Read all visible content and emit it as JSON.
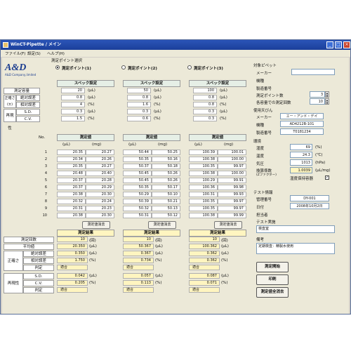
{
  "window": {
    "title": "WinCT-Pipette / メイン"
  },
  "menu": [
    "ファイル(F)",
    "設定(S)",
    "ヘルプ(H)"
  ],
  "logo": {
    "text": "A&D",
    "sub": "A&D Company,limited"
  },
  "selection": {
    "title": "測定ポイント選択",
    "points": [
      "測定ポイント(1)",
      "測定ポイント(2)",
      "測定ポイント(3)"
    ],
    "selected": 0
  },
  "spec": {
    "row_labels": {
      "volume": "測定容量",
      "accuracy": "正確さ(±)",
      "abs": "絶対誤差",
      "rel": "相対誤差",
      "repeat": "再現性",
      "sd": "S.D.",
      "cv": "C.V."
    },
    "header": "スペック設定",
    "columns": [
      {
        "volume": "20",
        "abs": "0.8",
        "rel": "4",
        "sd": "0.3",
        "cv": "1.5"
      },
      {
        "volume": "50",
        "abs": "0.8",
        "rel": "1.6",
        "sd": "0.3",
        "cv": "0.6"
      },
      {
        "volume": "100",
        "abs": "0.8",
        "rel": "0.8",
        "sd": "0.3",
        "cv": "0.3"
      }
    ],
    "units": {
      "volume": "(μL)",
      "abs": "(μL)",
      "rel": "(%)",
      "sd": "(μL)",
      "cv": "(%)"
    }
  },
  "measurement": {
    "header": "測定値",
    "sub": [
      "(μL)",
      "(mg)"
    ],
    "row_header": "No.",
    "rows": [
      "1",
      "2",
      "3",
      "4",
      "5",
      "6",
      "7",
      "8",
      "9",
      "10"
    ],
    "columns": [
      {
        "ul": [
          "20.35",
          "20.34",
          "20.35",
          "20.48",
          "20.37",
          "20.37",
          "20.38",
          "20.32",
          "20.31",
          "20.38"
        ],
        "mg": [
          "20.27",
          "20.26",
          "20.27",
          "20.40",
          "20.28",
          "20.29",
          "20.30",
          "20.24",
          "20.23",
          "20.30"
        ]
      },
      {
        "ul": [
          "50.44",
          "50.35",
          "50.37",
          "50.45",
          "50.45",
          "50.35",
          "50.29",
          "50.39",
          "50.32",
          "50.31"
        ],
        "mg": [
          "50.25",
          "50.16",
          "50.18",
          "50.26",
          "50.26",
          "50.17",
          "50.10",
          "50.21",
          "50.13",
          "50.12"
        ]
      },
      {
        "ul": [
          "100.39",
          "100.38",
          "100.35",
          "100.38",
          "100.29",
          "100.36",
          "100.31",
          "100.35",
          "100.35",
          "100.38"
        ],
        "mg": [
          "100.01",
          "100.00",
          "99.97",
          "100.00",
          "99.91",
          "99.98",
          "99.93",
          "99.97",
          "99.97",
          "99.99"
        ]
      }
    ],
    "clear_label": "測定値消去"
  },
  "results": {
    "header": "測定結果",
    "row_labels": {
      "count": "測定回数",
      "mean": "平均値",
      "accuracy": "正確さ",
      "abs": "絶対誤差",
      "rel": "相対誤差",
      "judge": "判定",
      "repeat": "再現性",
      "sd": "S.D.",
      "cv": "C.V.",
      "judge2": "判定"
    },
    "columns": [
      {
        "count": "10",
        "mean": "20.350",
        "abs": "0.350",
        "rel": "1.750",
        "judge": "適合",
        "sd": "0.042",
        "cv": "0.205",
        "judge2": "適合"
      },
      {
        "count": "10",
        "mean": "50.367",
        "abs": "0.367",
        "rel": "0.734",
        "judge": "適合",
        "sd": "0.057",
        "cv": "0.113",
        "judge2": "適合"
      },
      {
        "count": "10",
        "mean": "100.362",
        "abs": "0.362",
        "rel": "0.362",
        "judge": "適合",
        "sd": "0.087",
        "cv": "0.071",
        "judge2": "適合"
      }
    ],
    "units": {
      "count": "(回)",
      "mean": "(μL)",
      "abs": "(μL)",
      "rel": "(%)",
      "sd": "(μL)",
      "cv": "(%)"
    }
  },
  "target_pipette": {
    "title": "対象ピペット",
    "maker_label": "メーカー",
    "maker": "",
    "model_label": "機種",
    "model": "",
    "serial_label": "製造番号",
    "serial": "",
    "points_label": "測定ポイント数",
    "points": "3",
    "count_label": "各容量での測定回数",
    "count": "10"
  },
  "balance": {
    "title": "使用天びん",
    "maker_label": "メーカー",
    "maker": "エー・アンド・デイ",
    "model_label": "機種",
    "model": "AD4212B-101",
    "serial_label": "製造番号",
    "serial": "T0181234"
  },
  "environment": {
    "title": "環境",
    "humidity_label": "湿度",
    "humidity": "69",
    "humidity_unit": "(%)",
    "temp_label": "温度",
    "temp": "24.3",
    "temp_unit": "(℃)",
    "pressure_label": "気圧",
    "pressure": "1013",
    "pressure_unit": "(hPa)",
    "z_label": "換算係数",
    "z_label2": "(Zファクター)",
    "z": "1.0039",
    "z_unit": "(μL/mg)",
    "humid_container_label": "湿度保持容器",
    "humid_container_checked": true
  },
  "test_info": {
    "title": "テスト情報",
    "mgmt_label": "管理番号",
    "mgmt": "DY-001",
    "date_label": "日付",
    "date": "2008年10月2日",
    "person_label": "担当者",
    "person": "",
    "impl_label": "テスト実施",
    "impl": "検査室",
    "note_label": "備考",
    "note": "定期検査：精製水使用"
  },
  "buttons": {
    "start": "測定開始",
    "print": "印刷",
    "clear_all": "測定値全消去"
  }
}
